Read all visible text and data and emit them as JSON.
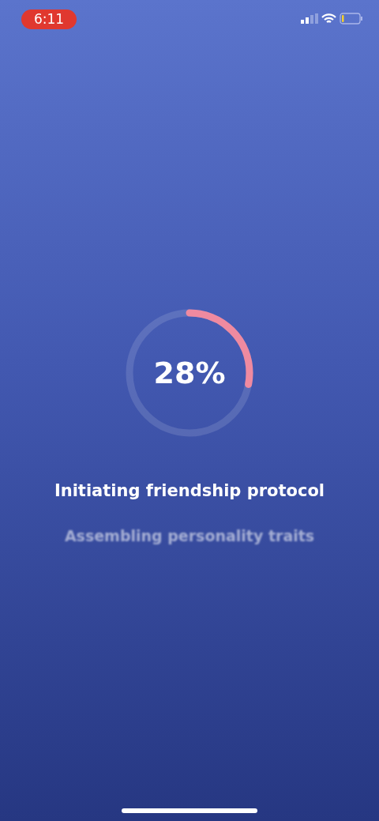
{
  "status_bar": {
    "time": "6:11"
  },
  "progress": {
    "level": 0.28,
    "reading": "28%"
  },
  "title": "Initiating friendship protocol",
  "subtitle": "Assembling personality traits"
}
